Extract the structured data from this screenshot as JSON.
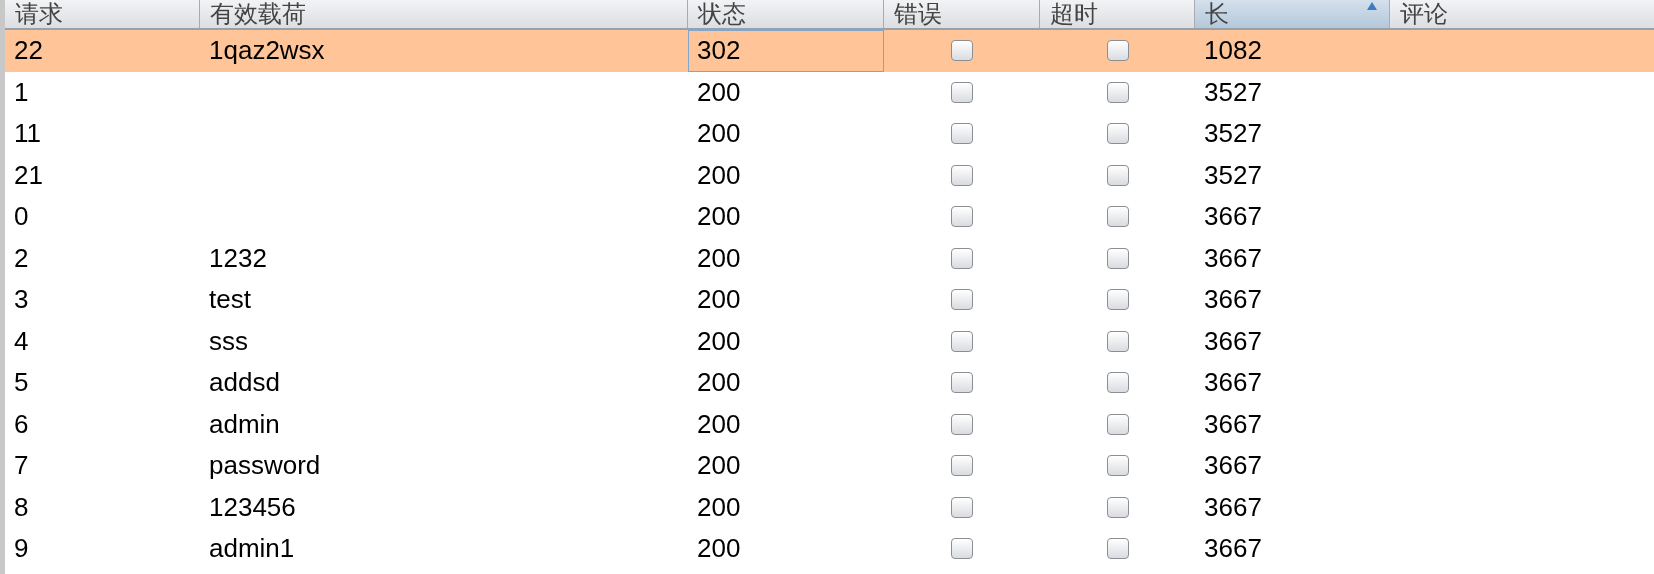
{
  "table": {
    "columns": [
      {
        "label": "请求",
        "sorted": false
      },
      {
        "label": "有效载荷",
        "sorted": false
      },
      {
        "label": "状态",
        "sorted": false
      },
      {
        "label": "错误",
        "sorted": false
      },
      {
        "label": "超时",
        "sorted": false
      },
      {
        "label": "长",
        "sorted": true
      },
      {
        "label": "评论",
        "sorted": false
      }
    ],
    "rows": [
      {
        "request": "22",
        "payload": "1qaz2wsx",
        "status": "302",
        "error": false,
        "timeout": false,
        "length": "1082",
        "selected": true,
        "focused": true
      },
      {
        "request": "1",
        "payload": "",
        "status": "200",
        "error": false,
        "timeout": false,
        "length": "3527",
        "selected": false,
        "focused": false
      },
      {
        "request": "11",
        "payload": "",
        "status": "200",
        "error": false,
        "timeout": false,
        "length": "3527",
        "selected": false,
        "focused": false
      },
      {
        "request": "21",
        "payload": "",
        "status": "200",
        "error": false,
        "timeout": false,
        "length": "3527",
        "selected": false,
        "focused": false
      },
      {
        "request": "0",
        "payload": "",
        "status": "200",
        "error": false,
        "timeout": false,
        "length": "3667",
        "selected": false,
        "focused": false
      },
      {
        "request": "2",
        "payload": "1232",
        "status": "200",
        "error": false,
        "timeout": false,
        "length": "3667",
        "selected": false,
        "focused": false
      },
      {
        "request": "3",
        "payload": "test",
        "status": "200",
        "error": false,
        "timeout": false,
        "length": "3667",
        "selected": false,
        "focused": false
      },
      {
        "request": "4",
        "payload": "sss",
        "status": "200",
        "error": false,
        "timeout": false,
        "length": "3667",
        "selected": false,
        "focused": false
      },
      {
        "request": "5",
        "payload": "addsd",
        "status": "200",
        "error": false,
        "timeout": false,
        "length": "3667",
        "selected": false,
        "focused": false
      },
      {
        "request": "6",
        "payload": "admin",
        "status": "200",
        "error": false,
        "timeout": false,
        "length": "3667",
        "selected": false,
        "focused": false
      },
      {
        "request": "7",
        "payload": "password",
        "status": "200",
        "error": false,
        "timeout": false,
        "length": "3667",
        "selected": false,
        "focused": false
      },
      {
        "request": "8",
        "payload": "123456",
        "status": "200",
        "error": false,
        "timeout": false,
        "length": "3667",
        "selected": false,
        "focused": false
      },
      {
        "request": "9",
        "payload": "admin1",
        "status": "200",
        "error": false,
        "timeout": false,
        "length": "3667",
        "selected": false,
        "focused": false
      }
    ]
  }
}
